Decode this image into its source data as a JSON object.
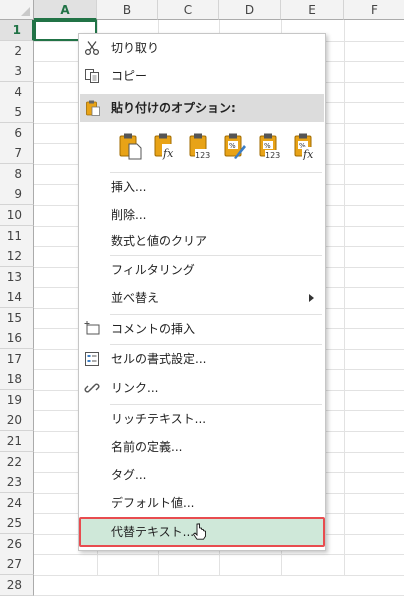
{
  "columns": [
    "A",
    "B",
    "C",
    "D",
    "E",
    "F"
  ],
  "active_column": "A",
  "rows": [
    "1",
    "2",
    "3",
    "4",
    "5",
    "6",
    "7",
    "8",
    "9",
    "10",
    "11",
    "12",
    "13",
    "14",
    "15",
    "16",
    "17",
    "18",
    "19",
    "20",
    "21",
    "22",
    "23",
    "24",
    "25",
    "26",
    "27",
    "28"
  ],
  "active_row": "1",
  "menu": {
    "cut": "切り取り",
    "copy": "コピー",
    "paste_options": "貼り付けのオプション:",
    "paste_icons": [
      "paste-icon",
      "paste-formulas-icon",
      "paste-values-icon",
      "paste-formatting-icon",
      "paste-values-number-format-icon",
      "paste-formulas-number-format-icon"
    ],
    "insert": "挿入...",
    "delete": "削除...",
    "clear_contents": "数式と値のクリア",
    "filtering": "フィルタリング",
    "sort": "並べ替え",
    "insert_comment": "コメントの挿入",
    "format_cells": "セルの書式設定...",
    "link": "リンク...",
    "rich_text": "リッチテキスト...",
    "define_name": "名前の定義...",
    "tag": "タグ...",
    "default_value": "デフォルト値...",
    "alt_text": "代替テキスト..."
  },
  "colors": {
    "accent": "#217346",
    "highlight_bg": "#cfe8d9",
    "highlight_border": "#e84c4f",
    "paste_icon_gold": "#e8a317"
  }
}
